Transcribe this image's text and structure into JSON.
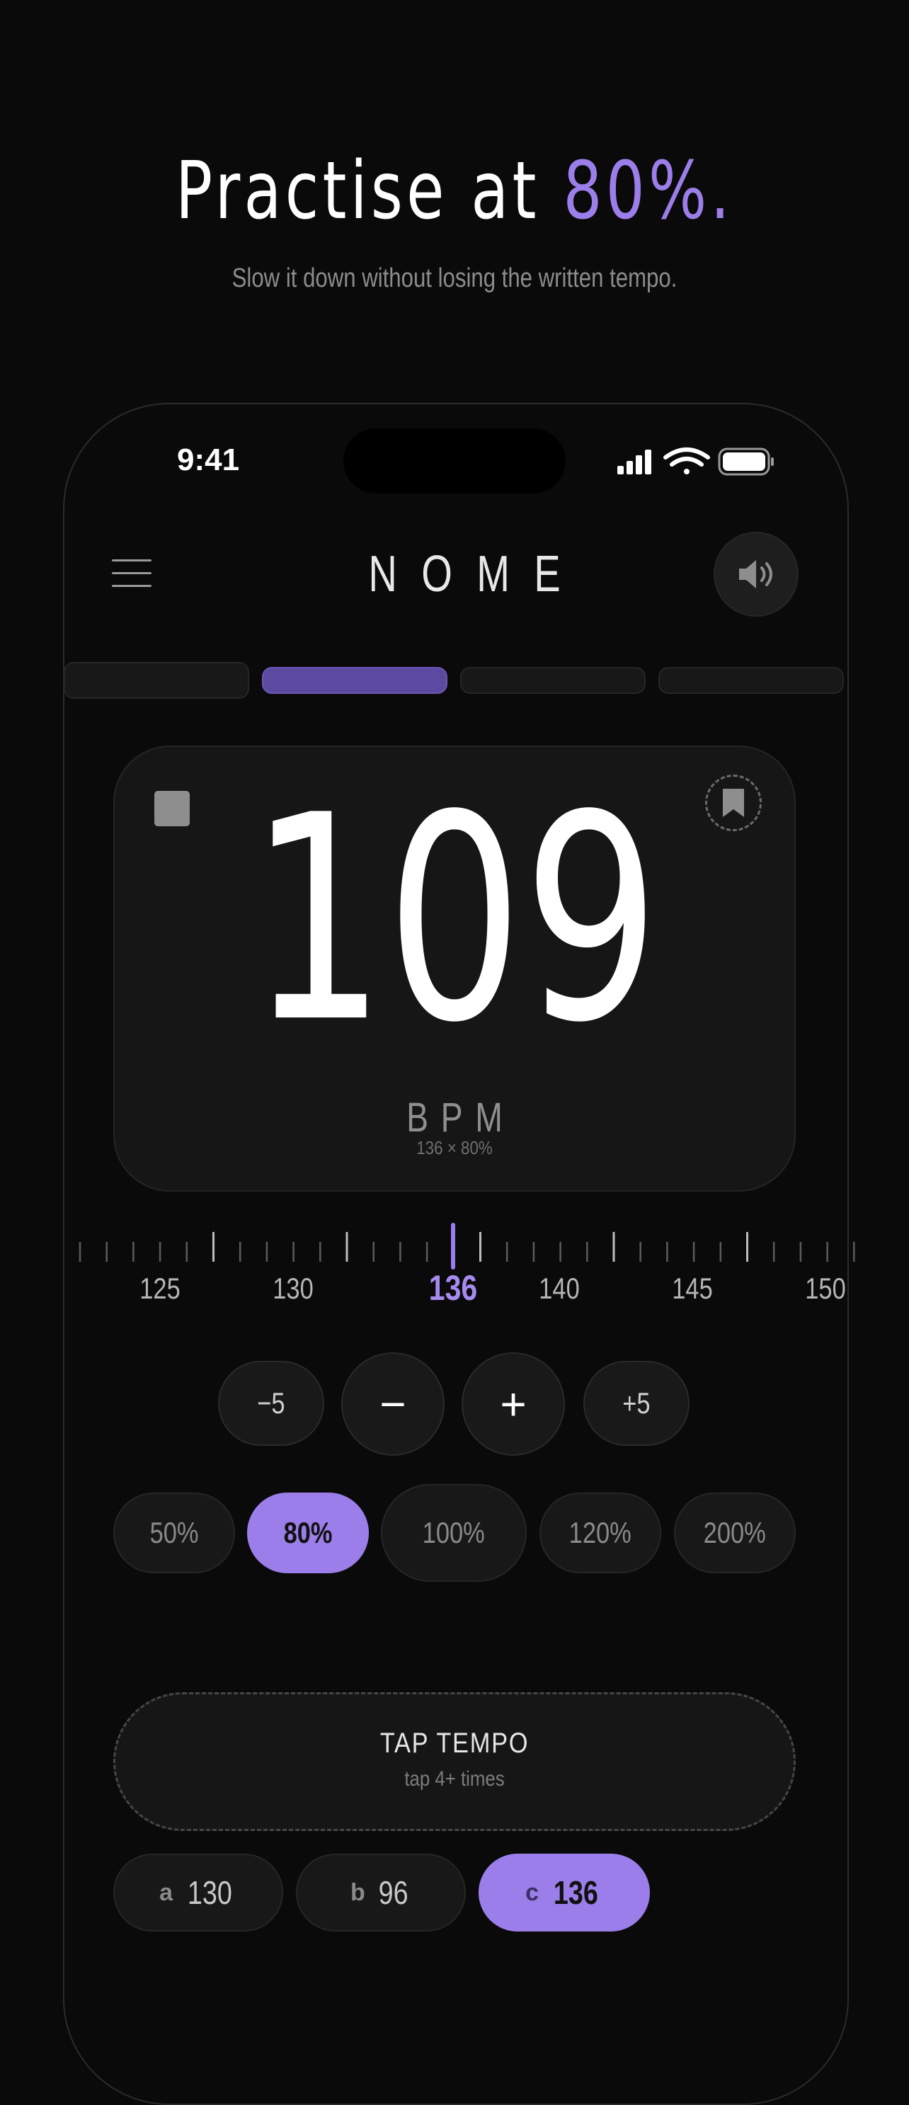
{
  "headline": {
    "prefix": "Practise at ",
    "accent": "80%."
  },
  "subtitle": "Slow it down without losing the written tempo.",
  "status_bar": {
    "time": "9:41"
  },
  "app": {
    "brand": "NOME"
  },
  "tabs": [
    {
      "active": false
    },
    {
      "active": true
    },
    {
      "active": false
    },
    {
      "active": false
    }
  ],
  "bpm": {
    "value": "109",
    "unit": "BPM",
    "formula": "136 × 80%"
  },
  "ruler": {
    "labels": [
      "125",
      "130",
      "136",
      "140",
      "145",
      "150"
    ],
    "current": "136"
  },
  "steppers": {
    "minus_five": "−5",
    "minus": "−",
    "plus": "+",
    "plus_five": "+5"
  },
  "percent_options": [
    {
      "label": "50%",
      "active": false
    },
    {
      "label": "80%",
      "active": true
    },
    {
      "label": "100%",
      "active": false
    },
    {
      "label": "120%",
      "active": false
    },
    {
      "label": "200%",
      "active": false
    }
  ],
  "tap_tempo": {
    "title": "TAP TEMPO",
    "hint": "tap 4+ times"
  },
  "presets": [
    {
      "key": "a",
      "value": "130",
      "active": false
    },
    {
      "key": "b",
      "value": "96",
      "active": false
    },
    {
      "key": "c",
      "value": "136",
      "active": true
    }
  ],
  "colors": {
    "accent": "#9b7ee9",
    "background": "#0a0a0a",
    "card": "#161616"
  }
}
